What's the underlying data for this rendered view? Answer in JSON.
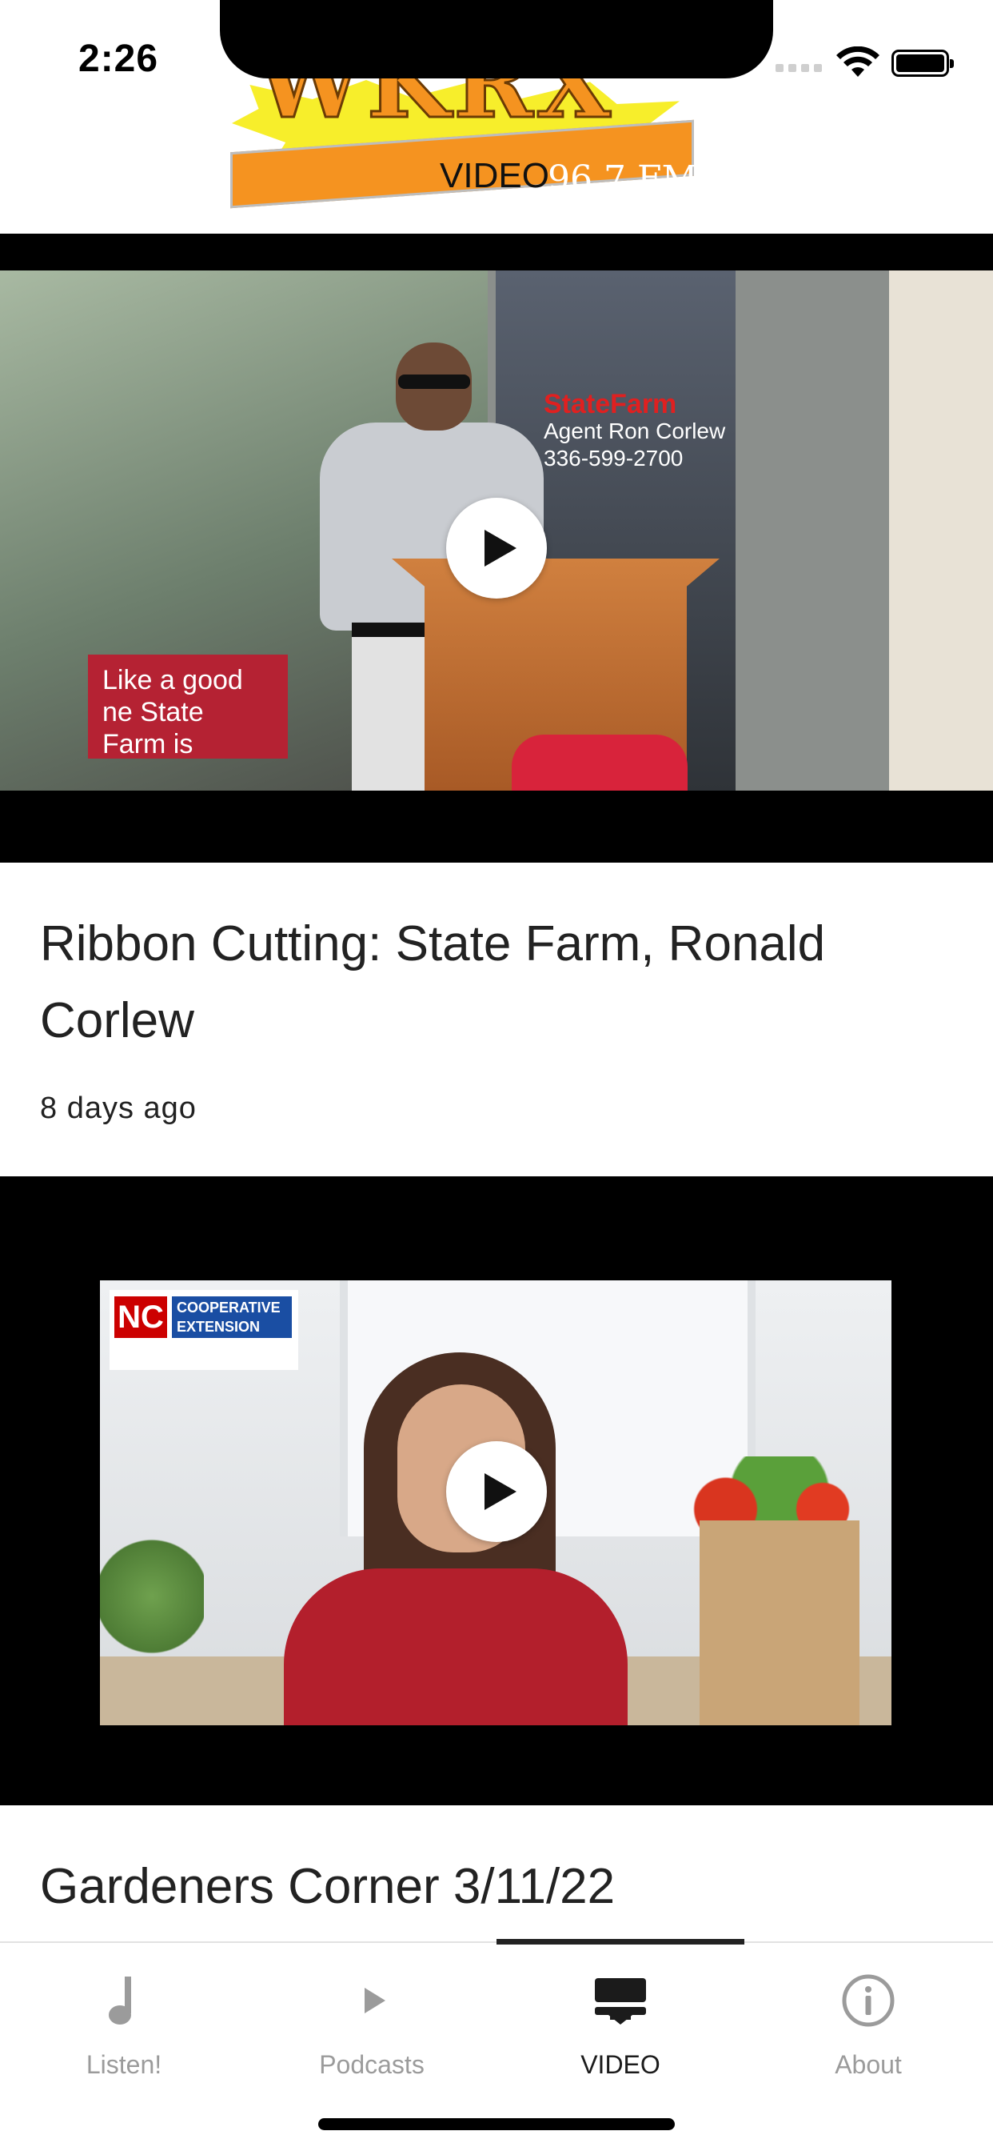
{
  "status_bar": {
    "time": "2:26"
  },
  "header": {
    "logo_letters": "WKRX",
    "logo_video": "VIDEO",
    "logo_frequency": "96.7 FM"
  },
  "videos": [
    {
      "title": "Ribbon Cutting: State Farm, Ronald Corlew",
      "age": "8 days ago",
      "thumb_sign_brand": "StateFarm",
      "thumb_sign_text": "Agent Ron Corlew 336-599-2700",
      "thumb_banner_text": "Like a good ne State Farm is"
    },
    {
      "title": "Gardeners Corner 3/11/22",
      "thumb_badge_nc": "NC",
      "thumb_badge_text": "COOPERATIVE EXTENSION"
    }
  ],
  "tabs": [
    {
      "label": "Listen!",
      "icon": "music-note-icon",
      "active": false
    },
    {
      "label": "Podcasts",
      "icon": "play-icon",
      "active": false
    },
    {
      "label": "VIDEO",
      "icon": "video-feed-icon",
      "active": true
    },
    {
      "label": "About",
      "icon": "info-icon",
      "active": false
    }
  ],
  "colors": {
    "active_tab": "#1b1b1b",
    "inactive_tab": "#9b9b9b",
    "logo_orange": "#f59320",
    "logo_yellow": "#f7ee2b"
  }
}
